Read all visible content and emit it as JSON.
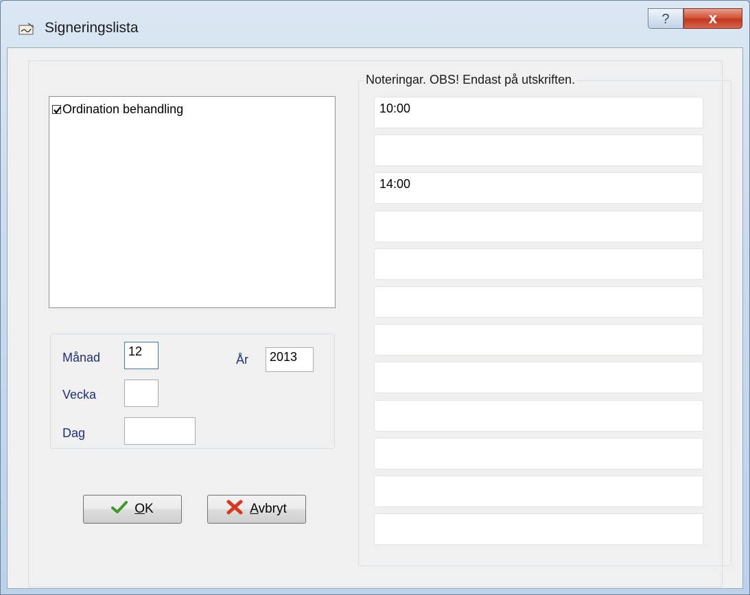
{
  "window": {
    "title": "Signeringslista",
    "help_label": "?",
    "close_label": "x"
  },
  "list": {
    "items": [
      {
        "label": "Ordination behandling",
        "checked": true
      }
    ]
  },
  "date": {
    "month_label": "Månad",
    "month_value": "12",
    "year_label": "År",
    "year_value": "2013",
    "week_label": "Vecka",
    "week_value": "",
    "day_label": "Dag",
    "day_value": ""
  },
  "buttons": {
    "ok_label": "OK",
    "ok_mnemonic": "O",
    "ok_rest": "K",
    "cancel_label": "Avbryt",
    "cancel_mnemonic": "A",
    "cancel_rest": "vbryt"
  },
  "notes": {
    "legend": "Noteringar. OBS! Endast på utskriften.",
    "fields": [
      "10:00",
      "",
      "14:00",
      "",
      "",
      "",
      "",
      "",
      "",
      "",
      "",
      ""
    ]
  },
  "colors": {
    "label_blue": "#1f2f7a",
    "ok_green": "#3a9a2a",
    "cancel_red": "#d9381e"
  }
}
